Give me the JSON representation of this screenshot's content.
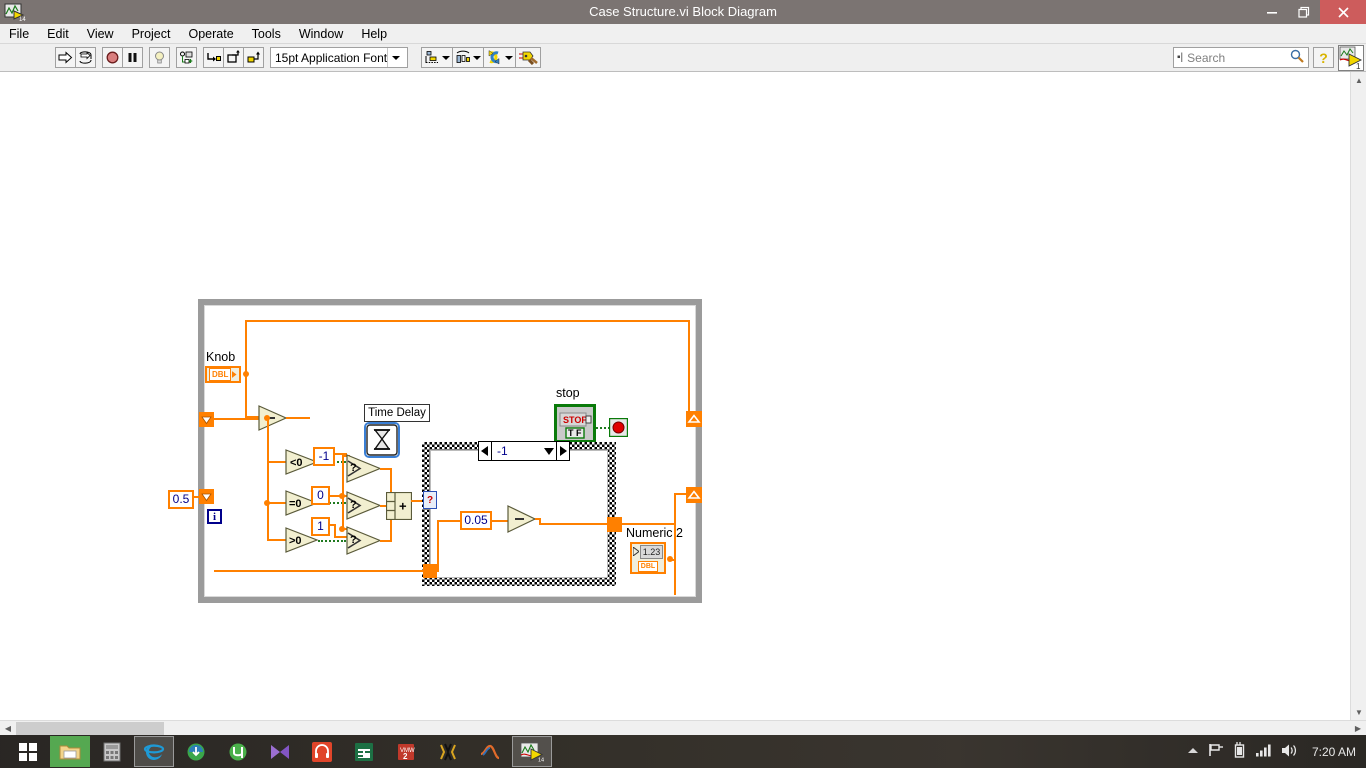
{
  "window": {
    "title": "Case Structure.vi Block Diagram",
    "app_icon": "labview-icon",
    "minimize": "–",
    "maximize": "❐",
    "close": "✕"
  },
  "menubar": {
    "items": [
      {
        "label": "File",
        "name": "menu-file"
      },
      {
        "label": "Edit",
        "name": "menu-edit"
      },
      {
        "label": "View",
        "name": "menu-view"
      },
      {
        "label": "Project",
        "name": "menu-project"
      },
      {
        "label": "Operate",
        "name": "menu-operate"
      },
      {
        "label": "Tools",
        "name": "menu-tools"
      },
      {
        "label": "Window",
        "name": "menu-window"
      },
      {
        "label": "Help",
        "name": "menu-help"
      }
    ]
  },
  "toolbar": {
    "run_icon": "run-arrow-icon",
    "run_continuous_icon": "run-continuously-icon",
    "abort_icon": "abort-execution-icon",
    "pause_icon": "pause-icon",
    "highlight_icon": "highlight-execution-lightbulb-icon",
    "retain_values_icon": "retain-wire-values-icon",
    "step_into_icon": "step-into-icon",
    "step_over_icon": "step-over-icon",
    "step_out_icon": "step-out-icon",
    "font_label": "15pt Application Font",
    "align_objects_icon": "align-objects-icon",
    "distribute_objects_icon": "distribute-objects-icon",
    "reorder_icon": "reorder-icon",
    "clean_up_diagram_icon": "clean-up-diagram-icon",
    "search_placeholder": "Search",
    "search_value": "",
    "search_icon": "magnifier-icon",
    "help_icon": "question-mark-icon",
    "context_help_icon": "context-help-icon"
  },
  "diagram": {
    "while_loop": {
      "name": "while-loop",
      "iteration_terminal": "i"
    },
    "knob": {
      "label": "Knob",
      "type": "DBL",
      "name": "knob-control-terminal"
    },
    "shift_register_left_top": "shift-register-left-top",
    "shift_register_left_bottom": "shift-register-left-bottom",
    "shift_register_right_top": "shift-register-right-top",
    "shift_register_right_bottom": "shift-register-right-bottom",
    "constants": {
      "half": "0.5",
      "neg_one": "-1",
      "zero": "0",
      "one": "1",
      "delta": "0.05"
    },
    "comparisons": [
      {
        "label": "<0",
        "name": "less-than-zero-node"
      },
      {
        "label": "=0",
        "name": "equal-to-zero-node"
      },
      {
        "label": ">0",
        "name": "greater-than-zero-node"
      }
    ],
    "select_nodes": [
      {
        "label": "?",
        "name": "select-node-top"
      },
      {
        "label": "?",
        "name": "select-node-middle"
      },
      {
        "label": "?",
        "name": "select-node-bottom"
      }
    ],
    "subtract_node_main": {
      "label": "–",
      "name": "subtract-node-main"
    },
    "subtract_node_case": {
      "label": "–",
      "name": "subtract-node-case"
    },
    "compound_arithmetic": {
      "label": "+",
      "name": "compound-arithmetic-node"
    },
    "time_delay": {
      "label": "Time Delay",
      "name": "time-delay-subvi",
      "icon": "hourglass-icon"
    },
    "stop": {
      "label": "stop",
      "button_text": "STOP",
      "type_text": "TF",
      "name": "stop-control-terminal",
      "loop_condition": "stop-if-true-terminal"
    },
    "case_structure": {
      "name": "case-structure",
      "selector_value": "-1",
      "prev_icon": "left-arrow-icon",
      "next_icon": "right-arrow-icon",
      "dropdown_icon": "chevron-down-icon",
      "selector_terminal": "?"
    },
    "numeric2": {
      "label": "Numeric 2",
      "value": "1.23",
      "type": "DBL",
      "name": "numeric-2-indicator"
    }
  },
  "scrollbars": {
    "v_up": "▲",
    "v_down": "▼",
    "h_left": "◀",
    "h_right": "▶"
  },
  "taskbar": {
    "start_icon": "windows-start-icon",
    "items": [
      {
        "name": "taskbar-file-explorer",
        "icon": "folder-icon"
      },
      {
        "name": "taskbar-calculator",
        "icon": "calculator-icon"
      },
      {
        "name": "taskbar-internet-explorer",
        "icon": "internet-explorer-icon"
      },
      {
        "name": "taskbar-idm",
        "icon": "download-manager-icon"
      },
      {
        "name": "taskbar-utorrent",
        "icon": "utorrent-icon"
      },
      {
        "name": "taskbar-kmplayer",
        "icon": "media-player-icon"
      },
      {
        "name": "taskbar-audio",
        "icon": "headphones-icon"
      },
      {
        "name": "taskbar-excel",
        "icon": "excel-icon"
      },
      {
        "name": "taskbar-vmware",
        "icon": "vmware-icon"
      },
      {
        "name": "taskbar-proteus",
        "icon": "proteus-icon"
      },
      {
        "name": "taskbar-matlab",
        "icon": "matlab-icon"
      },
      {
        "name": "taskbar-labview",
        "icon": "labview-icon"
      }
    ],
    "tray": {
      "show_hidden_icon": "chevron-up-icon",
      "flag_icon": "action-center-flag-icon",
      "battery_icon": "battery-icon",
      "network_icon": "network-signal-icon",
      "volume_icon": "volume-icon",
      "clock": "7:20 AM"
    }
  },
  "colors": {
    "title_bar": "#7b7472",
    "close_button": "#cd5c5c",
    "wire_orange": "#ff8000",
    "wire_boolean_green": "#1f7a1f",
    "loop_border": "#9b9b9b",
    "node_fill": "#f2efd0",
    "stop_green": "#0a7a0a",
    "taskbar": "#2b2824"
  }
}
